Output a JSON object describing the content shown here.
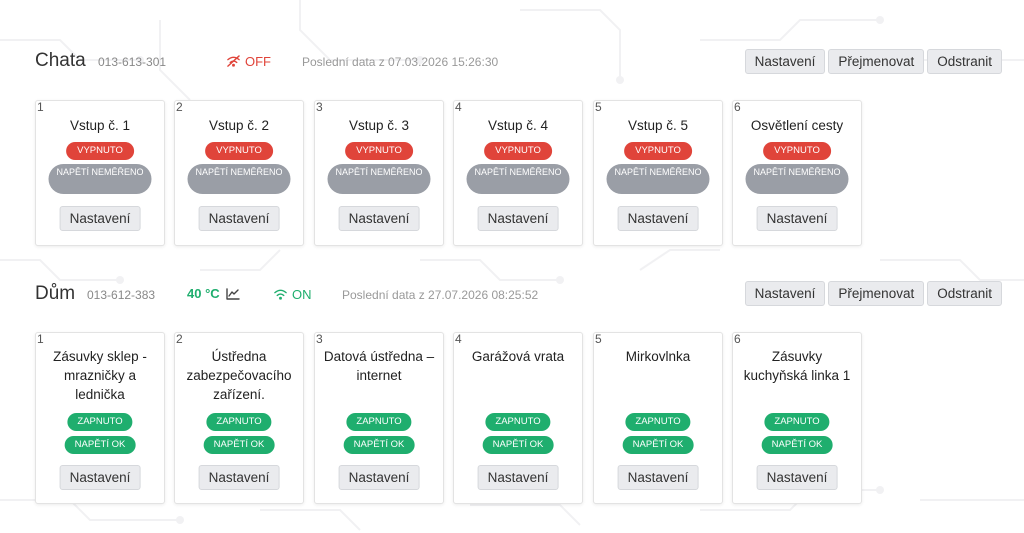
{
  "devices": [
    {
      "name": "Chata",
      "id": "013-613-301",
      "status": "OFF",
      "last_data": "Poslední data z 07.03.2026 15:26:30",
      "actions": [
        "Nastavení",
        "Přejmenovat",
        "Odstranit"
      ],
      "outputs": [
        {
          "num": "1",
          "title": "Vstup č. 1",
          "state": "VYPNUTO",
          "voltage": "NAPĚTÍ NEMĚŘENO",
          "button": "Nastavení"
        },
        {
          "num": "2",
          "title": "Vstup č. 2",
          "state": "VYPNUTO",
          "voltage": "NAPĚTÍ NEMĚŘENO",
          "button": "Nastavení"
        },
        {
          "num": "3",
          "title": "Vstup č. 3",
          "state": "VYPNUTO",
          "voltage": "NAPĚTÍ NEMĚŘENO",
          "button": "Nastavení"
        },
        {
          "num": "4",
          "title": "Vstup č. 4",
          "state": "VYPNUTO",
          "voltage": "NAPĚTÍ NEMĚŘENO",
          "button": "Nastavení"
        },
        {
          "num": "5",
          "title": "Vstup č. 5",
          "state": "VYPNUTO",
          "voltage": "NAPĚTÍ NEMĚŘENO",
          "button": "Nastavení"
        },
        {
          "num": "6",
          "title": "Osvětlení cesty",
          "state": "VYPNUTO",
          "voltage": "NAPĚTÍ NEMĚŘENO",
          "button": "Nastavení"
        }
      ]
    },
    {
      "name": "Dům",
      "id": "013-612-383",
      "temperature": "40 °C",
      "status": "ON",
      "last_data": "Poslední data z 27.07.2026 08:25:52",
      "actions": [
        "Nastavení",
        "Přejmenovat",
        "Odstranit"
      ],
      "outputs": [
        {
          "num": "1",
          "title": "Zásuvky sklep - mrazničky a lednička",
          "state": "ZAPNUTO",
          "voltage": "NAPĚTÍ OK",
          "button": "Nastavení"
        },
        {
          "num": "2",
          "title": "Ústředna zabezpečovacího zařízení.",
          "state": "ZAPNUTO",
          "voltage": "NAPĚTÍ OK",
          "button": "Nastavení"
        },
        {
          "num": "3",
          "title": "Datová ústředna – internet",
          "state": "ZAPNUTO",
          "voltage": "NAPĚTÍ OK",
          "button": "Nastavení"
        },
        {
          "num": "4",
          "title": "Garážová vrata",
          "state": "ZAPNUTO",
          "voltage": "NAPĚTÍ OK",
          "button": "Nastavení"
        },
        {
          "num": "5",
          "title": "Mirkovlnka",
          "state": "ZAPNUTO",
          "voltage": "NAPĚTÍ OK",
          "button": "Nastavení"
        },
        {
          "num": "6",
          "title": "Zásuvky kuchyňská linka 1",
          "state": "ZAPNUTO",
          "voltage": "NAPĚTÍ OK",
          "button": "Nastavení"
        }
      ]
    }
  ],
  "icons": {
    "off_icon": "wifi-off-icon",
    "on_icon": "wifi-icon",
    "chart_icon": "line-chart-icon"
  },
  "colors": {
    "off": "#e0443a",
    "on": "#1fae6e",
    "neutral": "#9a9ea6"
  }
}
